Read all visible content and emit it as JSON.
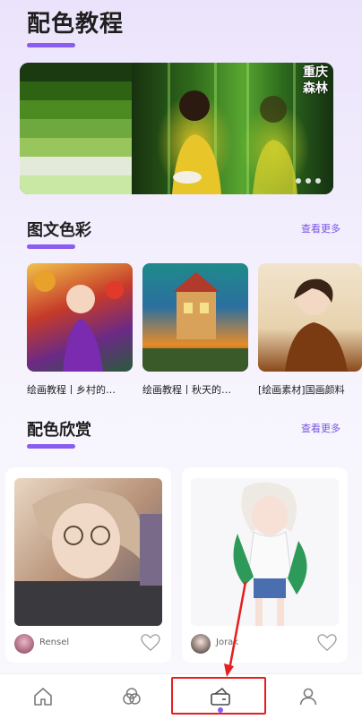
{
  "header": {
    "title": "配色教程"
  },
  "banner": {
    "tag_line1": "重庆",
    "tag_line2": "森林",
    "palette": [
      "#1b3a12",
      "#2f6314",
      "#4b8b22",
      "#6fa83e",
      "#98c65c",
      "#e3ead9",
      "#c8e8a4"
    ],
    "slides_count": 3
  },
  "sections": {
    "tutorials": {
      "title": "图文色彩",
      "more": "查看更多",
      "items": [
        {
          "caption": "绘画教程丨乡村的…"
        },
        {
          "caption": "绘画教程丨秋天的…"
        },
        {
          "caption": "[绘画素材]国画颜料"
        }
      ]
    },
    "gallery": {
      "title": "配色欣赏",
      "more": "查看更多",
      "items": [
        {
          "author": "Rensel"
        },
        {
          "author": "Jorak"
        }
      ]
    }
  },
  "bottom_nav": {
    "items": [
      "home-icon",
      "color-circles-icon",
      "palette-card-icon",
      "profile-icon"
    ],
    "active_index": 2
  },
  "colors": {
    "accent": "#8a5cf0",
    "highlight": "#e61e1e"
  }
}
